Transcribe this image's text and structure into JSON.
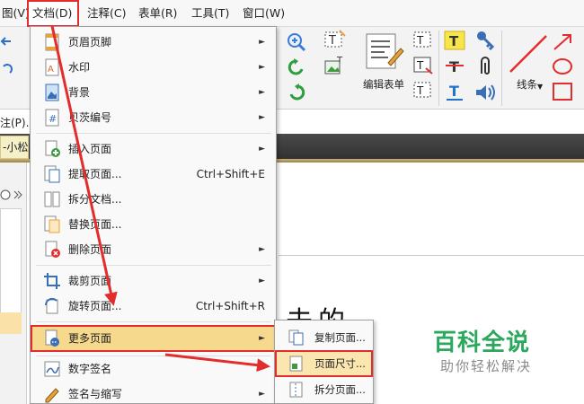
{
  "menubar": {
    "items": [
      {
        "label": "图(V)"
      },
      {
        "label": "文档(D)"
      },
      {
        "label": "注释(C)"
      },
      {
        "label": "表单(R)"
      },
      {
        "label": "工具(T)"
      },
      {
        "label": "窗口(W)"
      }
    ]
  },
  "ribbon": {
    "left_partial_label": "注(P)...",
    "edit_form_label": "编辑表单",
    "lines_label": "线条",
    "tab_partial": "-小松"
  },
  "doc_menu": {
    "items": [
      {
        "label": "页眉页脚",
        "submenu": true
      },
      {
        "label": "水印",
        "submenu": true
      },
      {
        "label": "背景",
        "submenu": true
      },
      {
        "label": "贝茨编号",
        "submenu": true
      },
      {
        "label": "插入页面",
        "submenu": true
      },
      {
        "label": "提取页面...",
        "shortcut": "Ctrl+Shift+E"
      },
      {
        "label": "拆分文档..."
      },
      {
        "label": "替换页面..."
      },
      {
        "label": "删除页面",
        "submenu": true
      },
      {
        "label": "裁剪页面",
        "submenu": true
      },
      {
        "label": "旋转页面...",
        "shortcut": "Ctrl+Shift+R"
      },
      {
        "label": "更多页面",
        "submenu": true,
        "highlighted": true
      },
      {
        "label": "数字签名",
        "submenu": true
      },
      {
        "label": "签名与缩写",
        "submenu": true
      }
    ]
  },
  "submenu": {
    "items": [
      {
        "label": "复制页面..."
      },
      {
        "label": "页面尺寸...",
        "highlighted": true
      },
      {
        "label": "拆分页面..."
      }
    ]
  },
  "document": {
    "handwriting": "未的"
  },
  "watermark": {
    "title": "百科全说",
    "subtitle": "助你轻松解决"
  },
  "colors": {
    "highlight_border": "#e32d2d",
    "arrow": "#e32d2d",
    "menu_highlight": "#f6d98c",
    "watermark_green": "#2aa85c"
  }
}
